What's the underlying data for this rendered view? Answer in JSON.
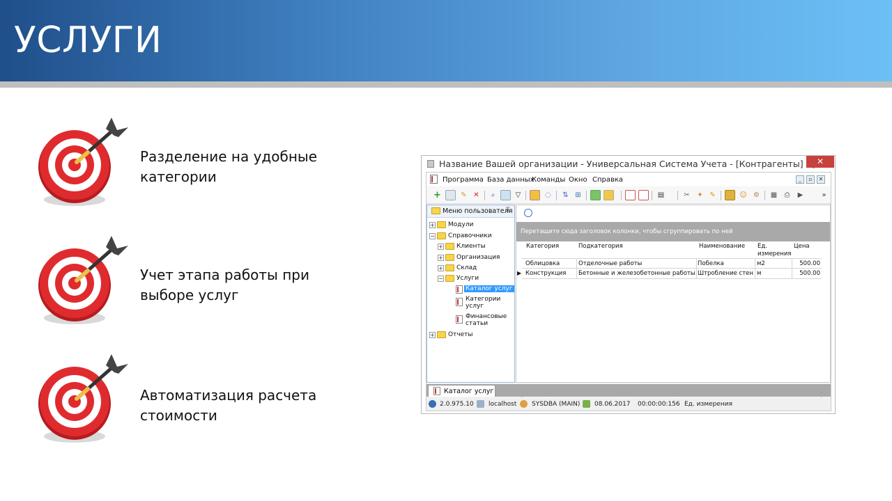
{
  "slide": {
    "title": "УСЛУГИ",
    "bullets": [
      {
        "line1": "Разделение на удобные",
        "line2": "категории"
      },
      {
        "line1": "Учет этапа работы при",
        "line2": "выборе услуг"
      },
      {
        "line1": "Автоматизация расчета",
        "line2": "стоимости"
      }
    ]
  },
  "colors": {
    "header_dark": "#1f4f8a",
    "header_light": "#6cc0f6",
    "target_red": "#d8262a",
    "selection_blue": "#3399ff",
    "group_band": "#a9a9a9"
  },
  "app": {
    "window_title": "Название Вашей организации - Универсальная Система Учета - [Контрагенты] - [...",
    "close_glyph": "✕",
    "menu": [
      "Программа",
      "База данных",
      "Команды",
      "Окно",
      "Справка"
    ],
    "mdi_buttons": [
      "_",
      "▫",
      "✕"
    ],
    "left_panel": {
      "title": "Меню пользователя",
      "pin_glyph": "⊼",
      "tree": {
        "modules": "Модули",
        "directories": "Справочники",
        "clients": "Клиенты",
        "organization": "Организация",
        "warehouse": "Склад",
        "services": "Услуги",
        "service_catalog": "Каталог услуг",
        "service_categories_1": "Категории",
        "service_categories_2": "услуг",
        "finance_items_1": "Финансовые",
        "finance_items_2": "статьи",
        "reports": "Отчеты"
      },
      "expand_glyph": "+",
      "collapse_glyph": "−"
    },
    "grid": {
      "group_hint": "Перетащите сюда заголовок колонки, чтобы сгруппировать по ней",
      "headers": {
        "category": "Категория",
        "subcategory": "Подкатегория",
        "name": "Наименование",
        "unit_1": "Ед.",
        "unit_2": "измерения",
        "price": "Цена"
      },
      "rows": [
        {
          "category": "Облицовка",
          "subcategory": "Отделочные работы",
          "name": "Побелка",
          "unit": "м2",
          "price": "500.00"
        },
        {
          "category": "Конструкция",
          "subcategory": "Бетонные и железобетонные работы",
          "name": "Штробление стен",
          "unit": "м",
          "price": "500.00"
        }
      ],
      "row_pointer": "▶"
    },
    "tab": "Каталог услуг",
    "status": {
      "version": "2.0.975.10",
      "host": "localhost",
      "user": "SYSDBA (MAIN)",
      "date": "08.06.2017",
      "timer": "00:00:00:156",
      "field": "Ед. измерения"
    }
  }
}
